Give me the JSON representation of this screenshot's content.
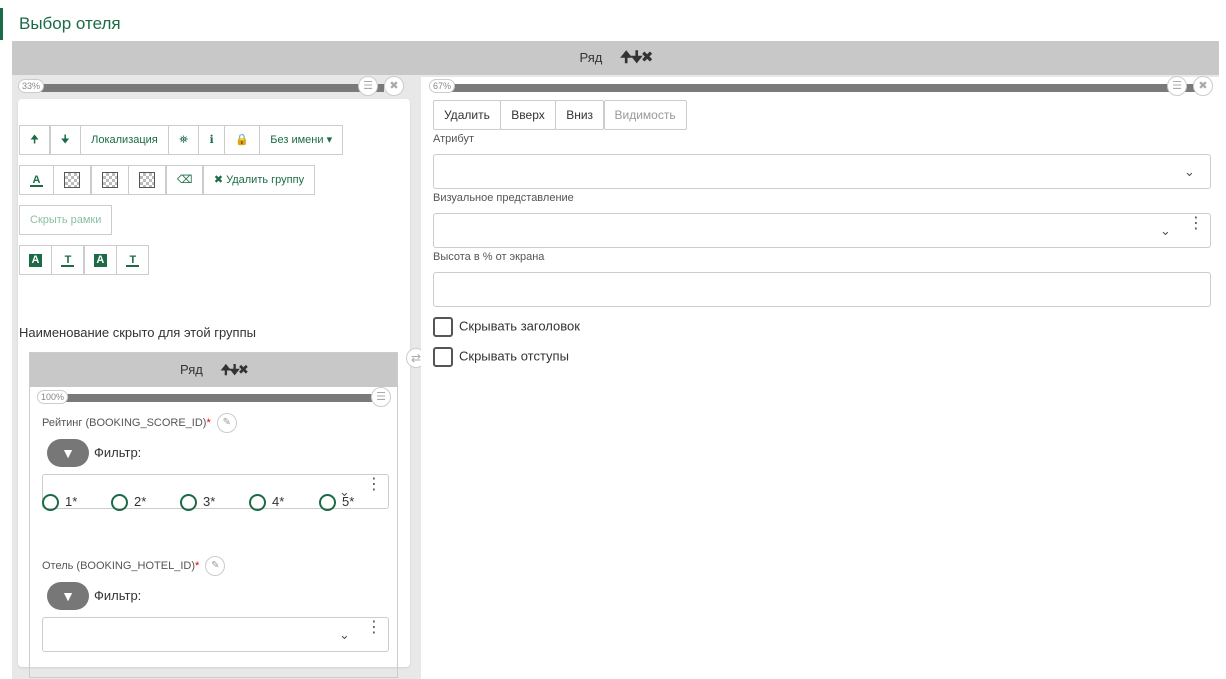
{
  "page": {
    "title": "Выбор отеля"
  },
  "row": {
    "label": "Ряд",
    "controls": "🠉🠋✖"
  },
  "left_col": {
    "percent": "33%",
    "toolbar1": [
      {
        "icon": "arrow-up-icon",
        "glyph": "🠉"
      },
      {
        "icon": "arrow-down-icon",
        "glyph": "🠋"
      },
      {
        "label": "Локализация"
      },
      {
        "icon": "binoculars-icon",
        "glyph": "⛯"
      },
      {
        "icon": "info-icon",
        "glyph": "ℹ"
      },
      {
        "icon": "lock-icon",
        "glyph": "🔒"
      },
      {
        "label": "Без имени ▾"
      }
    ],
    "delete_group": "✖ Удалить группу",
    "hide_frames": "Скрыть рамки",
    "hidden_note": "Наименование скрыто для этой группы",
    "inner_row": {
      "label": "Ряд",
      "controls": "🠉🠋✖",
      "percent": "100%",
      "fields": [
        {
          "label": "Рейтинг (BOOKING_SCORE_ID)",
          "required": "*",
          "filter": "Фильтр:"
        },
        {
          "label": "Отель (BOOKING_HOTEL_ID)",
          "required": "*",
          "filter": "Фильтр:"
        }
      ],
      "ratings": [
        "1*",
        "2*",
        "3*",
        "4*",
        "5*"
      ]
    }
  },
  "right_col": {
    "percent": "67%",
    "buttons": [
      "Удалить",
      "Вверх",
      "Вниз",
      "Видимость"
    ],
    "attr_label": "Атрибут",
    "visual_label": "Визуальное представление",
    "height_label": "Высота в % от экрана",
    "hide_header": "Скрывать заголовок",
    "hide_padding": "Скрывать отступы"
  },
  "colors": {
    "accent": "#1b6b47",
    "header_bg": "#c8c8c8",
    "bar": "#7a7a7a"
  }
}
